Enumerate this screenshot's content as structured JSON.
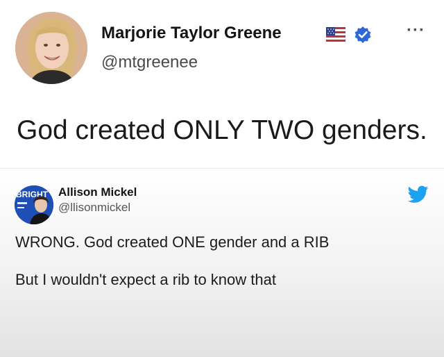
{
  "main_tweet": {
    "author": {
      "display_name": "Marjorie Taylor Greene",
      "handle": "@mtgreenee",
      "avatar_icon": "profile-photo",
      "badges": [
        "us-flag-icon",
        "verified-badge-icon"
      ]
    },
    "menu_glyph": "···",
    "text": "God created ONLY TWO genders."
  },
  "reply_tweet": {
    "author": {
      "display_name": "Allison Mickel",
      "handle": "@llisonmickel",
      "avatar_icon": "profile-photo",
      "avatar_overlay_text": "BRIGHT"
    },
    "platform_icon": "twitter-bird-icon",
    "lines": [
      "WRONG. God created ONE gender and a RIB",
      "But I wouldn't expect a rib to know that"
    ]
  },
  "colors": {
    "verified_blue": "#2f67d8",
    "twitter_blue": "#1da1f2",
    "text_dark": "#1a1a1a",
    "text_muted": "#555555"
  }
}
